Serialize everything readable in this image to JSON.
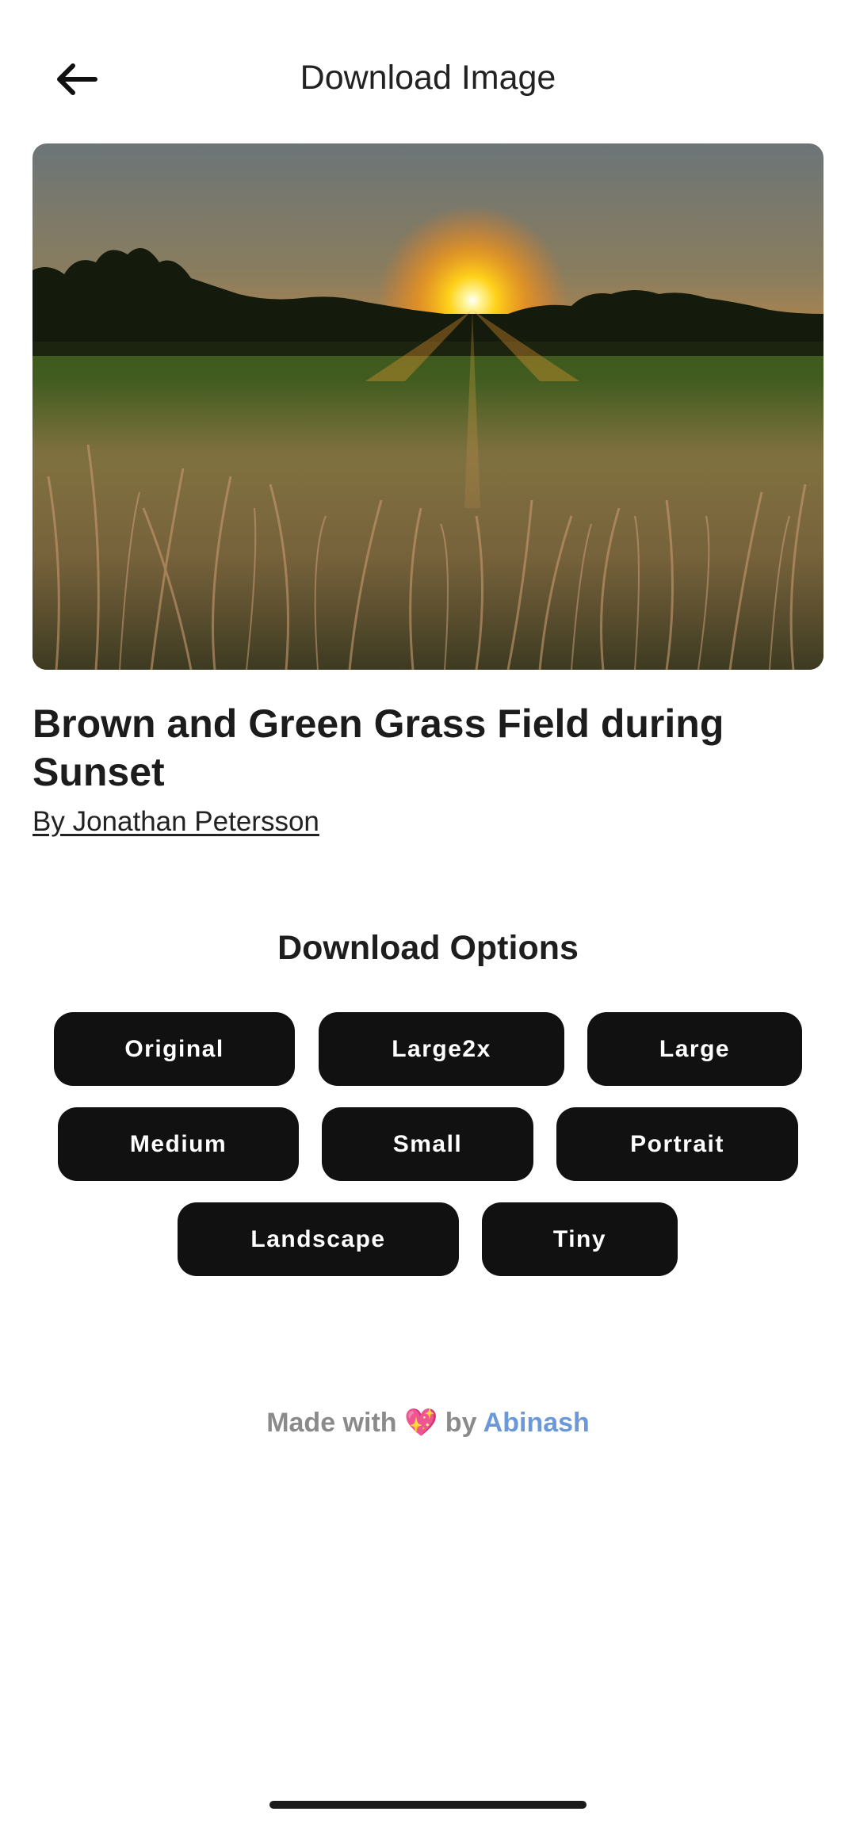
{
  "header": {
    "title": "Download Image",
    "back_icon": "arrow-left-icon"
  },
  "image": {
    "title": "Brown and Green Grass Field during Sunset",
    "author": "By Jonathan Petersson"
  },
  "download": {
    "heading": "Download Options",
    "options": [
      "Original",
      "Large2x",
      "Large",
      "Medium",
      "Small",
      "Portrait",
      "Landscape",
      "Tiny"
    ]
  },
  "footer": {
    "prefix": "Made with",
    "heart": "💖",
    "by": "by",
    "author": "Abinash"
  },
  "colors": {
    "button_bg": "#111111",
    "button_text": "#ffffff",
    "footer_text": "#8a8a8a",
    "footer_link": "#6a98d8",
    "heart": "#e7609a"
  }
}
